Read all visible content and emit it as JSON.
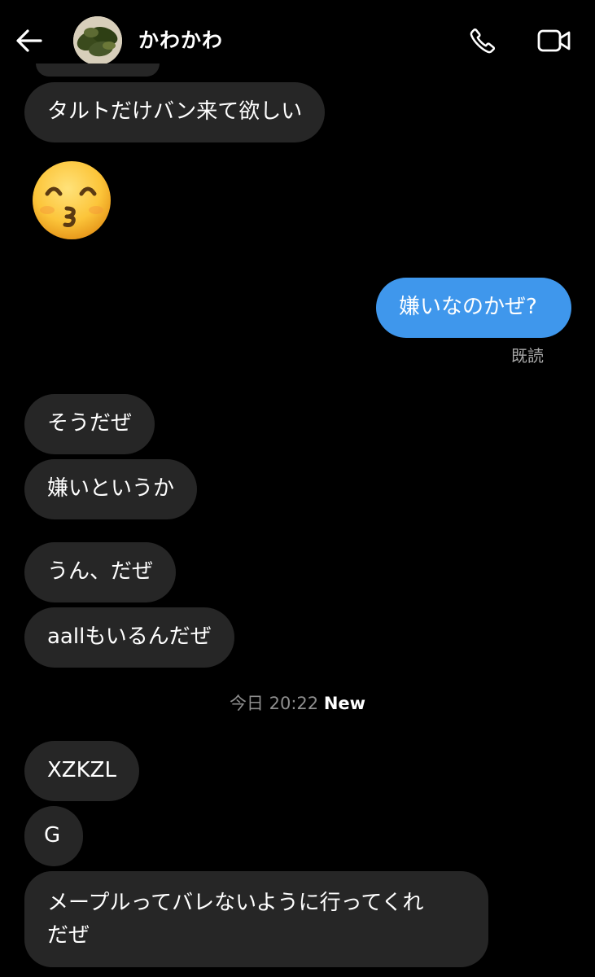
{
  "header": {
    "contact_name": "かわかわ",
    "back_icon": "back-arrow-icon",
    "call_icon": "phone-icon",
    "video_icon": "video-camera-icon"
  },
  "messages": [
    {
      "sender": "them",
      "text": "タルトだけバン来て欲しい"
    },
    {
      "sender": "them",
      "emoji": "kissing-face-with-smiling-eyes"
    },
    {
      "sender": "me",
      "text": "嫌いなのかぜ?"
    },
    {
      "sender": "them",
      "text": "そうだぜ"
    },
    {
      "sender": "them",
      "text": "嫌いというか"
    },
    {
      "sender": "them",
      "text": "うん、だぜ"
    },
    {
      "sender": "them",
      "text": "aallもいるんだぜ"
    },
    {
      "sender": "them",
      "text": "XZKZL"
    },
    {
      "sender": "them",
      "text": "G"
    },
    {
      "sender": "them",
      "text_line1": "メープルってバレないように行ってくれ",
      "text_line2": "だぜ"
    }
  ],
  "read_receipt": "既読",
  "timestamp": {
    "date": "今日 20:22",
    "new_label": "New"
  },
  "colors": {
    "background": "#000000",
    "incoming_bubble": "#262626",
    "outgoing_bubble": "#3f97ec",
    "muted_text": "#8e8e8e"
  }
}
